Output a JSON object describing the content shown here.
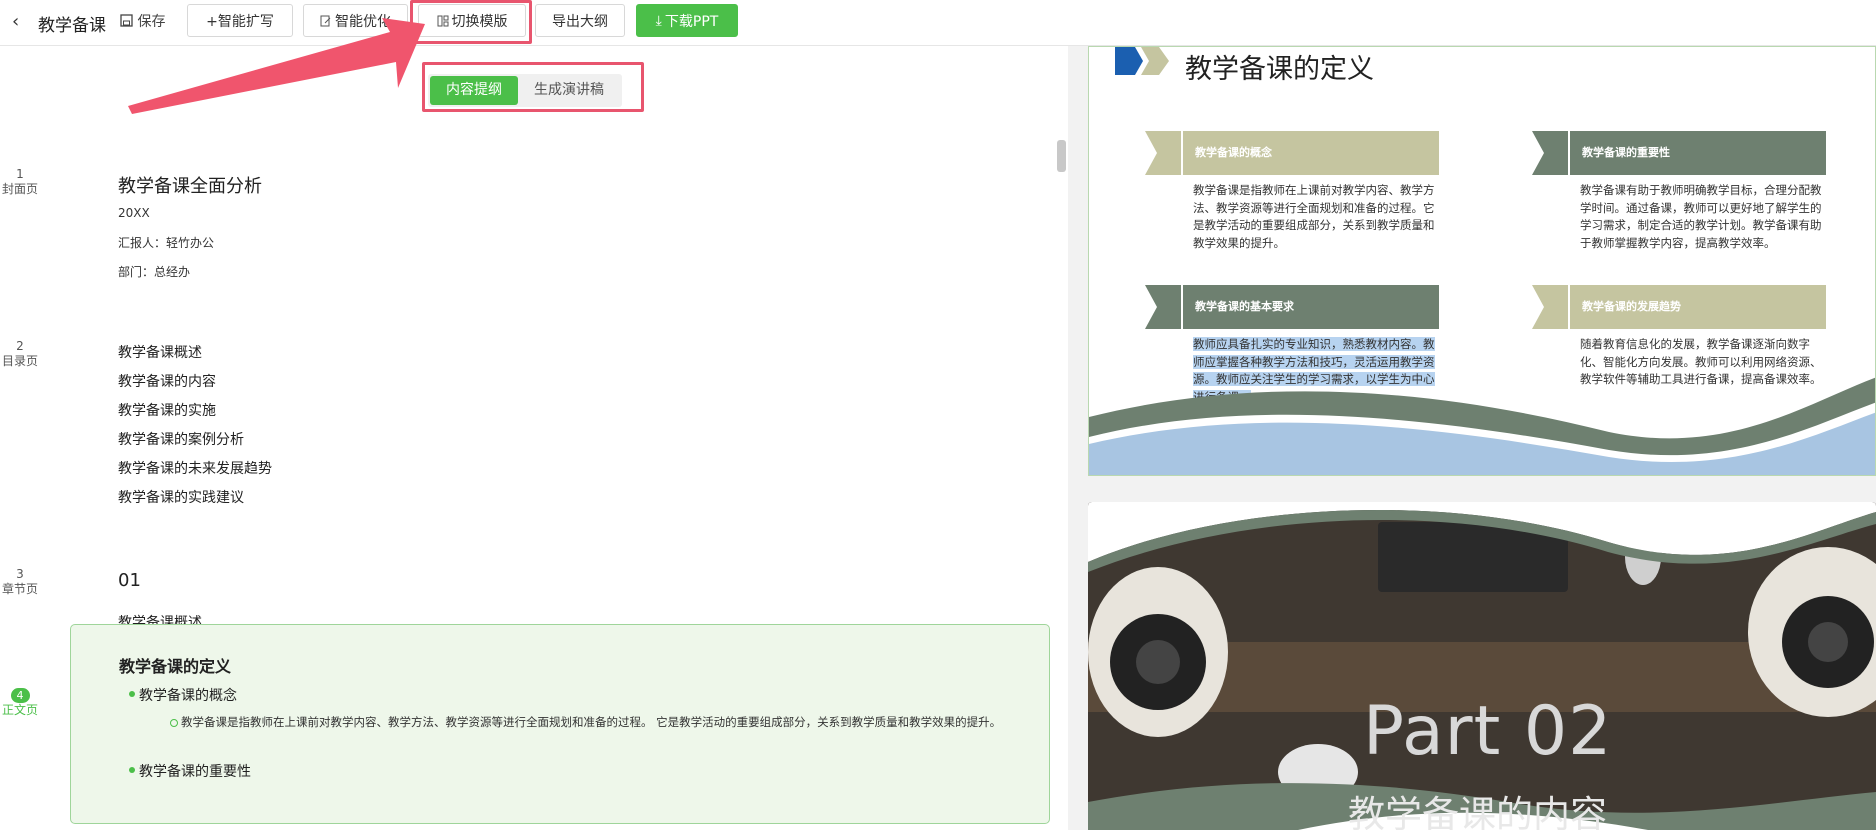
{
  "toolbar": {
    "back_icon": "‹",
    "title": "教学备课",
    "save": "保存",
    "expand": "+智能扩写",
    "optimize": "智能优化",
    "switch_template": "切换模版",
    "export_outline": "导出大纲",
    "download_ppt": "下载PPT"
  },
  "mode_tabs": {
    "outline": "内容提纲",
    "script": "生成演讲稿"
  },
  "pages": [
    {
      "num": "1",
      "type": "封面页"
    },
    {
      "num": "2",
      "type": "目录页"
    },
    {
      "num": "3",
      "type": "章节页"
    },
    {
      "num": "4",
      "type": "正文页"
    }
  ],
  "cover": {
    "title": "教学备课全面分析",
    "year": "20XX",
    "reporter": "汇报人：轻竹办公",
    "dept": "部门：总经办"
  },
  "toc": [
    "教学备课概述",
    "教学备课的内容",
    "教学备课的实施",
    "教学备课的案例分析",
    "教学备课的未来发展趋势",
    "教学备课的实践建议"
  ],
  "chapter": {
    "num": "01",
    "title": "教学备课概述"
  },
  "card": {
    "heading": "教学备课的定义",
    "b1": "教学备课的概念",
    "b1_text": "教学备课是指教师在上课前对教学内容、教学方法、教学资源等进行全面规划和准备的过程。 它是教学活动的重要组成部分，关系到教学质量和教学效果的提升。",
    "b2": "教学备课的重要性"
  },
  "slide1": {
    "title": "教学备课的定义",
    "boxes": [
      {
        "label": "教学备课的概念",
        "text": "教学备课是指教师在上课前对教学内容、教学方法、教学资源等进行全面规划和准备的过程。它是教学活动的重要组成部分，关系到教学质量和教学效果的提升。"
      },
      {
        "label": "教学备课的重要性",
        "text": "教学备课有助于教师明确教学目标，合理分配教学时间。通过备课，教师可以更好地了解学生的学习需求，制定合适的教学计划。教学备课有助于教师掌握教学内容，提高教学效率。"
      },
      {
        "label": "教学备课的基本要求",
        "text": "教师应具备扎实的专业知识，熟悉教材内容。教师应掌握各种教学方法和技巧，灵活运用教学资源。教师应关注学生的学习需求，以学生为中心进行备课。"
      },
      {
        "label": "教学备课的发展趋势",
        "text": "随着教育信息化的发展，教学备课逐渐向数字化、智能化方向发展。教师可以利用网络资源、教学软件等辅助工具进行备课，提高备课效率。"
      }
    ]
  },
  "slide2": {
    "part": "Part 02",
    "subtitle": "教学备课的内容"
  },
  "colors": {
    "green": "#4bbf49",
    "highlight": "#e8556e",
    "khaki": "#c5c5a0",
    "sage": "#6e8070",
    "blue": "#a8c5e2"
  }
}
